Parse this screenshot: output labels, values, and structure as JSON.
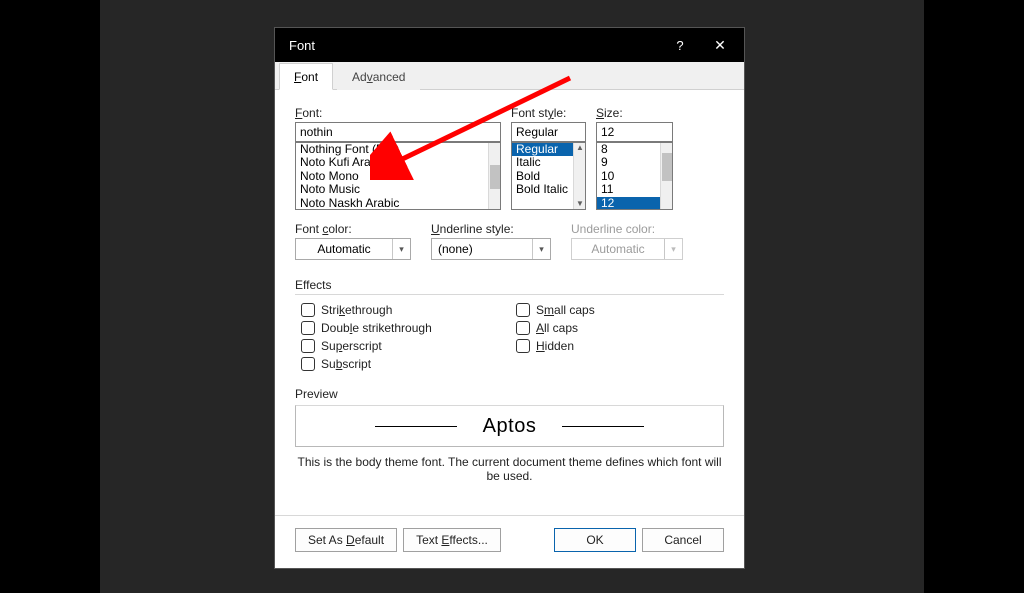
{
  "dialog": {
    "title": "Font",
    "help_icon": "?",
    "close_icon": "✕"
  },
  "tabs": {
    "font": "Font",
    "advanced": "Advanced"
  },
  "labels": {
    "font": "Font:",
    "font_style": "Font style:",
    "size": "Size:",
    "font_color": "Font color:",
    "underline_style": "Underline style:",
    "underline_color": "Underline color:",
    "effects": "Effects",
    "preview": "Preview"
  },
  "font": {
    "value": "nothin",
    "list": [
      "Nothing Font (5x7)",
      "Noto Kufi Arabic",
      "Noto Mono",
      "Noto Music",
      "Noto Naskh Arabic"
    ]
  },
  "style": {
    "value": "Regular",
    "list": [
      "Regular",
      "Italic",
      "Bold",
      "Bold Italic"
    ],
    "selected_index": 0
  },
  "size": {
    "value": "12",
    "list": [
      "8",
      "9",
      "10",
      "11",
      "12"
    ],
    "selected_index": 4
  },
  "combos": {
    "font_color": "Automatic",
    "underline_style": "(none)",
    "underline_color": "Automatic"
  },
  "effects": {
    "strikethrough": "Strikethrough",
    "double_strike": "Double strikethrough",
    "superscript": "Superscript",
    "subscript": "Subscript",
    "small_caps": "Small caps",
    "all_caps": "All caps",
    "hidden": "Hidden"
  },
  "preview": {
    "sample": "Aptos",
    "note": "This is the body theme font. The current document theme defines which font will be used."
  },
  "buttons": {
    "set_default": "Set As Default",
    "text_effects": "Text Effects...",
    "ok": "OK",
    "cancel": "Cancel"
  }
}
